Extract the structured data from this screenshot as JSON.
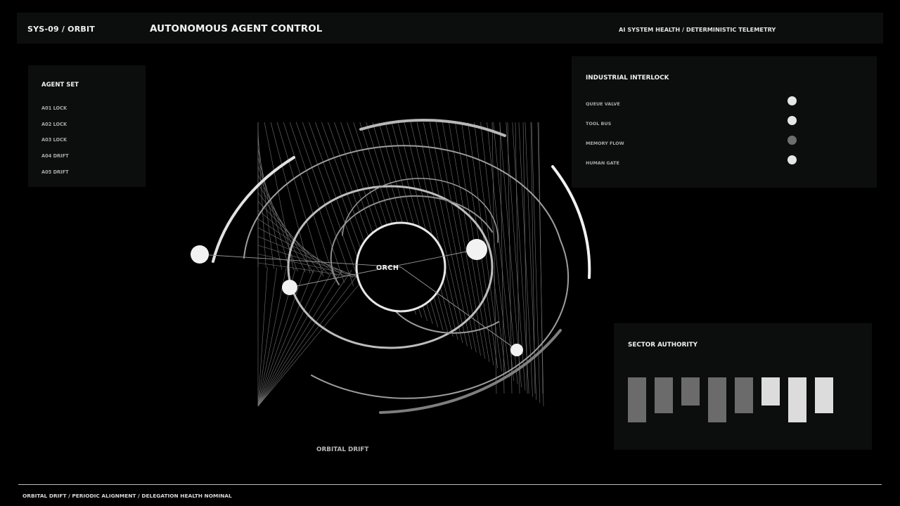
{
  "header": {
    "system_id": "SYS-09 / ORBIT",
    "title": "AUTONOMOUS AGENT CONTROL",
    "health": "AI SYSTEM HEALTH / DETERMINISTIC TELEMETRY"
  },
  "agent_set": {
    "title": "AGENT SET",
    "items": [
      {
        "label": "A01 LOCK"
      },
      {
        "label": "A02 LOCK"
      },
      {
        "label": "A03 LOCK"
      },
      {
        "label": "A04 DRIFT"
      },
      {
        "label": "A05 DRIFT"
      }
    ]
  },
  "interlock": {
    "title": "INDUSTRIAL INTERLOCK",
    "items": [
      {
        "label": "QUEUE VALVE",
        "status_color": "#e6e6e6"
      },
      {
        "label": "TOOL BUS",
        "status_color": "#e6e6e6"
      },
      {
        "label": "MEMORY FLOW",
        "status_color": "#6e6e6e"
      },
      {
        "label": "HUMAN GATE",
        "status_color": "#e6e6e6"
      }
    ]
  },
  "sector_authority": {
    "title": "SECTOR AUTHORITY",
    "bars": [
      {
        "offset": 0,
        "level": 1.0,
        "color": "#6b6b6b"
      },
      {
        "offset": 0,
        "level": 0.8,
        "color": "#6b6b6b"
      },
      {
        "offset": 0,
        "level": 0.62,
        "color": "#6b6b6b"
      },
      {
        "offset": 0,
        "level": 1.0,
        "color": "#6b6b6b"
      },
      {
        "offset": 0,
        "level": 0.8,
        "color": "#6b6b6b"
      },
      {
        "offset": 0,
        "level": 0.62,
        "color": "#dcdcdc"
      },
      {
        "offset": 0,
        "level": 1.0,
        "color": "#dcdcdc"
      },
      {
        "offset": 0,
        "level": 0.8,
        "color": "#dcdcdc"
      }
    ]
  },
  "orbit": {
    "center_label": "ORCH",
    "caption": "ORBITAL DRIFT"
  },
  "footer": {
    "status": "ORBITAL DRIFT / PERIODIC ALIGNMENT / DELEGATION HEALTH NOMINAL"
  }
}
